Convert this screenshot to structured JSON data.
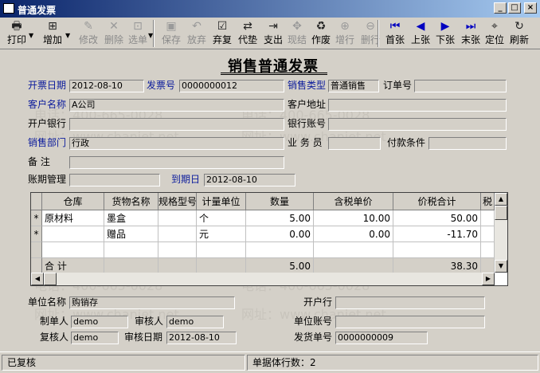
{
  "window": {
    "title": "普通发票",
    "btn_min": "_",
    "btn_max": "□",
    "btn_close": "×"
  },
  "toolbar": [
    {
      "label": "打印",
      "icon": "printer-icon",
      "glyph": "🖶",
      "dropdown": true,
      "enabled": true
    },
    {
      "label": "增加",
      "icon": "add-doc-icon",
      "glyph": "⊞",
      "dropdown": true,
      "enabled": true
    },
    {
      "label": "修改",
      "icon": "edit-icon",
      "glyph": "✎",
      "enabled": false
    },
    {
      "label": "删除",
      "icon": "delete-icon",
      "glyph": "✕",
      "enabled": false
    },
    {
      "label": "选单",
      "icon": "select-doc-icon",
      "glyph": "⊡",
      "dropdown": true,
      "enabled": false
    },
    {
      "label": "保存",
      "icon": "save-icon",
      "glyph": "▣",
      "enabled": false
    },
    {
      "label": "放弃",
      "icon": "undo-icon",
      "glyph": "↶",
      "enabled": false
    },
    {
      "label": "弃复",
      "icon": "unapprove-icon",
      "glyph": "☑",
      "enabled": true
    },
    {
      "label": "代垫",
      "icon": "advance-icon",
      "glyph": "⇄",
      "enabled": true
    },
    {
      "label": "支出",
      "icon": "expense-icon",
      "glyph": "⇥",
      "enabled": true
    },
    {
      "label": "现结",
      "icon": "cash-settle-icon",
      "glyph": "✥",
      "enabled": false
    },
    {
      "label": "作废",
      "icon": "void-icon",
      "glyph": "♻",
      "enabled": true
    },
    {
      "label": "增行",
      "icon": "add-row-icon",
      "glyph": "⊕",
      "enabled": false
    },
    {
      "label": "删行",
      "icon": "delete-row-icon",
      "glyph": "⊖",
      "enabled": false
    },
    {
      "label": "首张",
      "icon": "first-record-icon",
      "glyph": "⏮",
      "enabled": true,
      "blue": true
    },
    {
      "label": "上张",
      "icon": "prev-record-icon",
      "glyph": "◀",
      "enabled": true,
      "blue": true
    },
    {
      "label": "下张",
      "icon": "next-record-icon",
      "glyph": "▶",
      "enabled": true,
      "blue": true
    },
    {
      "label": "末张",
      "icon": "last-record-icon",
      "glyph": "⏭",
      "enabled": true,
      "blue": true
    },
    {
      "label": "定位",
      "icon": "locate-icon",
      "glyph": "⌖",
      "enabled": true
    },
    {
      "label": "刷新",
      "icon": "refresh-icon",
      "glyph": "↻",
      "enabled": true
    }
  ],
  "doc": {
    "title": "销售普通发票"
  },
  "fields": {
    "invoice_date": {
      "label": "开票日期",
      "value": "2012-08-10"
    },
    "invoice_no": {
      "label": "发票号",
      "value": "0000000012"
    },
    "sales_type": {
      "label": "销售类型",
      "value": "普通销售"
    },
    "order_no": {
      "label": "订单号",
      "value": ""
    },
    "customer_name": {
      "label": "客户名称",
      "value": "A公司"
    },
    "customer_address": {
      "label": "客户地址",
      "value": ""
    },
    "bank": {
      "label": "开户银行",
      "value": ""
    },
    "bank_account": {
      "label": "银行账号",
      "value": ""
    },
    "sales_dept": {
      "label": "销售部门",
      "value": "行政"
    },
    "salesman": {
      "label": "业 务 员",
      "value": ""
    },
    "payment_terms": {
      "label": "付款条件",
      "value": ""
    },
    "remark": {
      "label": "备    注",
      "value": ""
    },
    "account_mgmt": {
      "label": "账期管理",
      "value": ""
    },
    "due_date": {
      "label": "到期日",
      "value": "2012-08-10"
    }
  },
  "grid": {
    "columns": [
      "仓库",
      "货物名称",
      "规格型号",
      "计量单位",
      "数量",
      "含税单价",
      "价税合计",
      "税"
    ],
    "rows": [
      {
        "marker": "*",
        "warehouse": "原材料",
        "item": "墨盒",
        "spec": "",
        "unit": "个",
        "qty": "5.00",
        "price": "10.00",
        "total": "50.00"
      },
      {
        "marker": "*",
        "warehouse": "",
        "item": "赠品",
        "spec": "",
        "unit": "元",
        "qty": "0.00",
        "price": "0.00",
        "total": "-11.70"
      },
      {
        "marker": "",
        "warehouse": "",
        "item": "",
        "spec": "",
        "unit": "",
        "qty": "",
        "price": "",
        "total": ""
      }
    ],
    "total_row": {
      "label": "合 计",
      "qty": "5.00",
      "total": "38.30"
    }
  },
  "footer": {
    "unit_name": {
      "label": "单位名称",
      "value": "购销存"
    },
    "bank": {
      "label": "开户行",
      "value": ""
    },
    "maker": {
      "label": "制单人",
      "value": "demo"
    },
    "reviewer": {
      "label": "审核人",
      "value": "demo"
    },
    "unit_account": {
      "label": "单位账号",
      "value": ""
    },
    "rechecker": {
      "label": "复核人",
      "value": "demo"
    },
    "review_date": {
      "label": "审核日期",
      "value": "2012-08-10"
    },
    "delivery_no": {
      "label": "发货单号",
      "value": "0000000009"
    }
  },
  "watermark": {
    "phone": "电话：400-665-0028",
    "site": "网址：www.chanjet.net"
  },
  "status": {
    "state": "已复核",
    "rows": "单据体行数：2"
  }
}
